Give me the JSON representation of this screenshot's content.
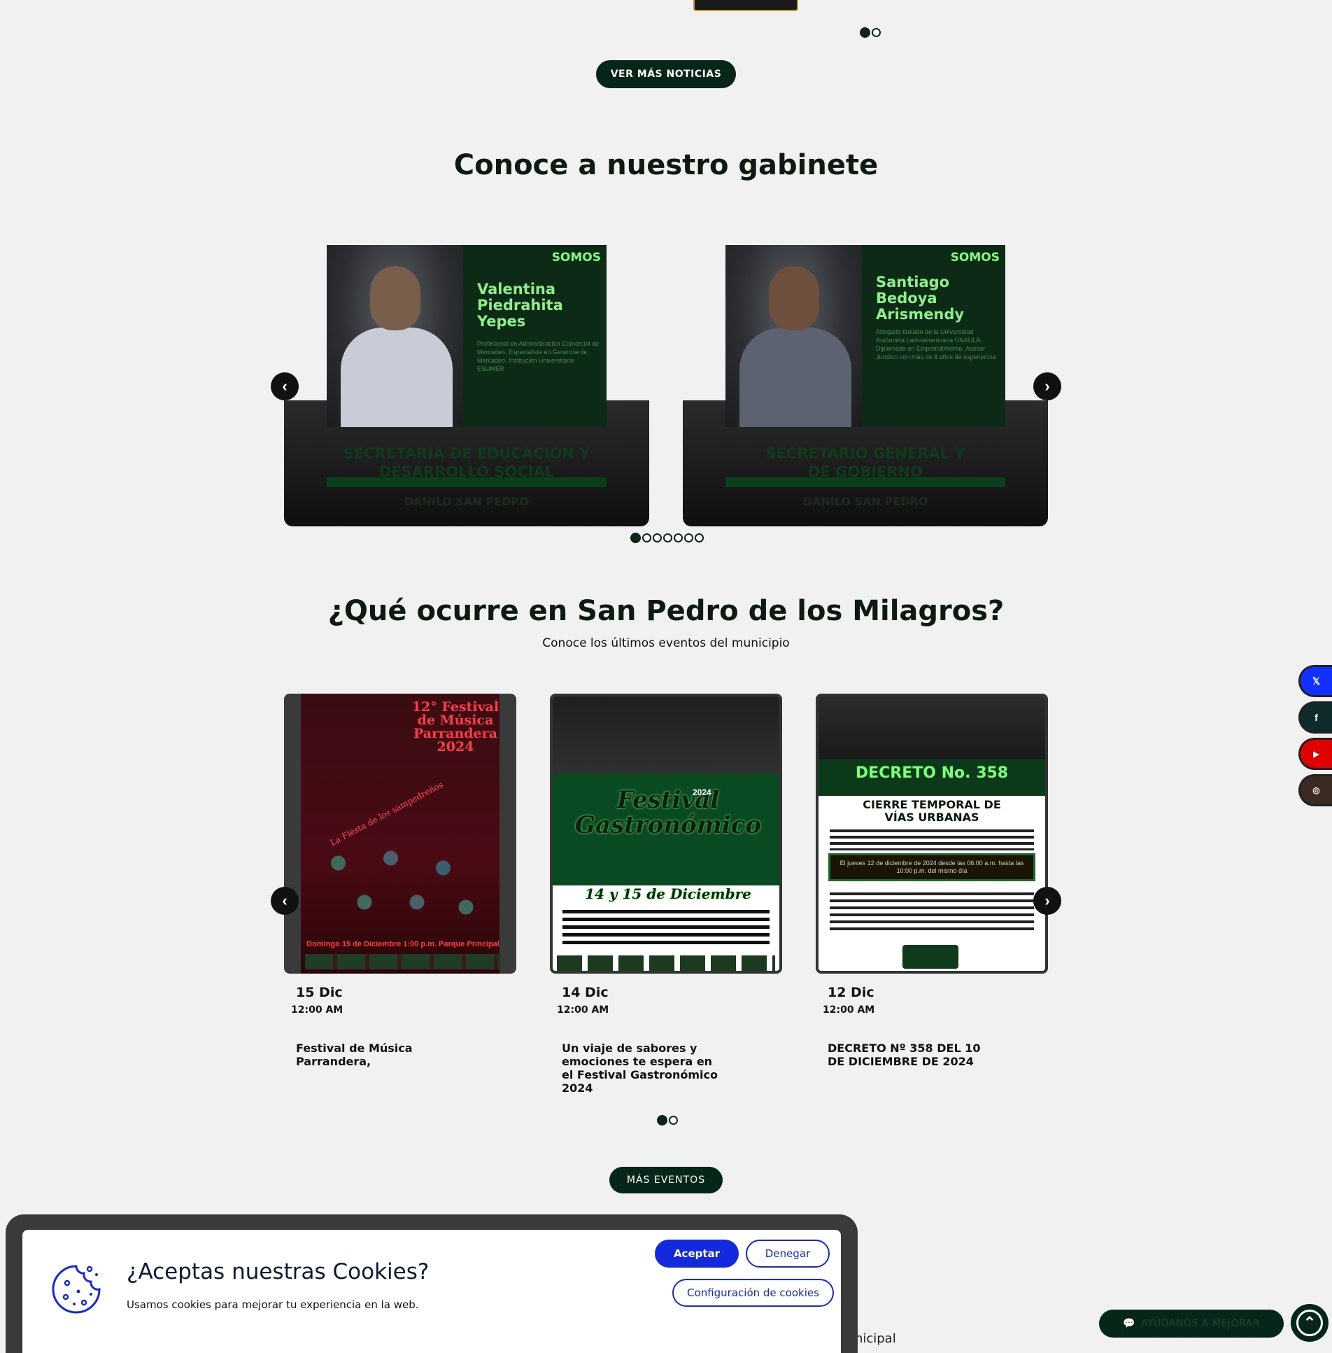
{
  "news": {
    "pagination": [
      "1",
      "2"
    ],
    "button_label": "VER MÁS NOTICIAS"
  },
  "gabinete": {
    "title": "Conoce a nuestro gabinete",
    "cards": [
      {
        "somos": "SOMOS",
        "name": "Valentina Piedrahita Yepes",
        "desc": "Profesional en Administración Comercial de Mercadeo. Especialista en Gerencia de Mercadeo. Institución Universitaria ESUMER",
        "role": "SECRETARIA DE EDUCACIÓN Y DESARROLLO SOCIAL",
        "logo": "DANILO  SAN PEDRO"
      },
      {
        "somos": "SOMOS",
        "name": "Santiago Bedoya Arismendy",
        "desc": "Abogado titulado de la Universidad Autónoma Latinoamericana UNAULA. Diplomado en Emprendimiento. Asesor Jurídico con más de 8 años de experiencia",
        "role": "SECRETARIO GENERAL Y DE GOBIERNO",
        "logo": "DANILO  SAN PEDRO"
      }
    ],
    "dots": 7,
    "prev_icon": "chevron-left-icon",
    "next_icon": "chevron-right-icon"
  },
  "events": {
    "title": "¿Qué ocurre en San Pedro de los Milagros?",
    "subtitle": "Conoce los últimos eventos del municipio",
    "items": [
      {
        "poster_main": "12° Festival de Música Parrandera 2024",
        "poster_side": "La Fiesta de los sampedreños",
        "poster_foot": "Domingo 15 de Diciembre 1:00 p.m. Parque Principal",
        "date": "15 Dic",
        "time": "12:00 AM",
        "title": "Festival de Música Parrandera,"
      },
      {
        "poster_main": "Festival Gastronómico",
        "poster_side": "2024",
        "poster_foot": "14 y 15 de Diciembre",
        "date": "14 Dic",
        "time": "12:00 AM",
        "title": "Un viaje de sabores y emociones te espera en el Festival Gastronómico 2024"
      },
      {
        "poster_main": "DECRETO No. 358",
        "poster_side": "CIERRE TEMPORAL DE VÍAS URBANAS",
        "poster_foot": "El jueves 12 de diciembre de 2024 desde las 06:00 a.m. hasta las 10:00 p.m. del mismo día",
        "date": "12 Dic",
        "time": "12:00 AM",
        "title": "DECRETO Nº 358 DEL 10 DE DICIEMBRE DE 2024"
      }
    ],
    "pagination": [
      "1",
      "2"
    ],
    "button_label": "MÁS EVENTOS"
  },
  "social": [
    {
      "icon": "x-icon",
      "glyph": "𝕏",
      "color": "#1230ff"
    },
    {
      "icon": "facebook-icon",
      "glyph": "f",
      "color": "#0f2a2a"
    },
    {
      "icon": "youtube-icon",
      "glyph": "▶",
      "color": "#e00000"
    },
    {
      "icon": "instagram-icon",
      "glyph": "◎",
      "color": "#3a2a22"
    }
  ],
  "feedback": {
    "label": "AYÚDANOS A MEJORAR",
    "icon": "chat-icon"
  },
  "scroll_top_icon": "chevron-up-icon",
  "footer_partial": "Municipal",
  "cookies": {
    "title": "¿Aceptas nuestras Cookies?",
    "text": "Usamos cookies para mejorar tu experiencia en la web.",
    "accept": "Aceptar",
    "deny": "Denegar",
    "config": "Configuración de cookies",
    "accent": "#1428e0"
  }
}
